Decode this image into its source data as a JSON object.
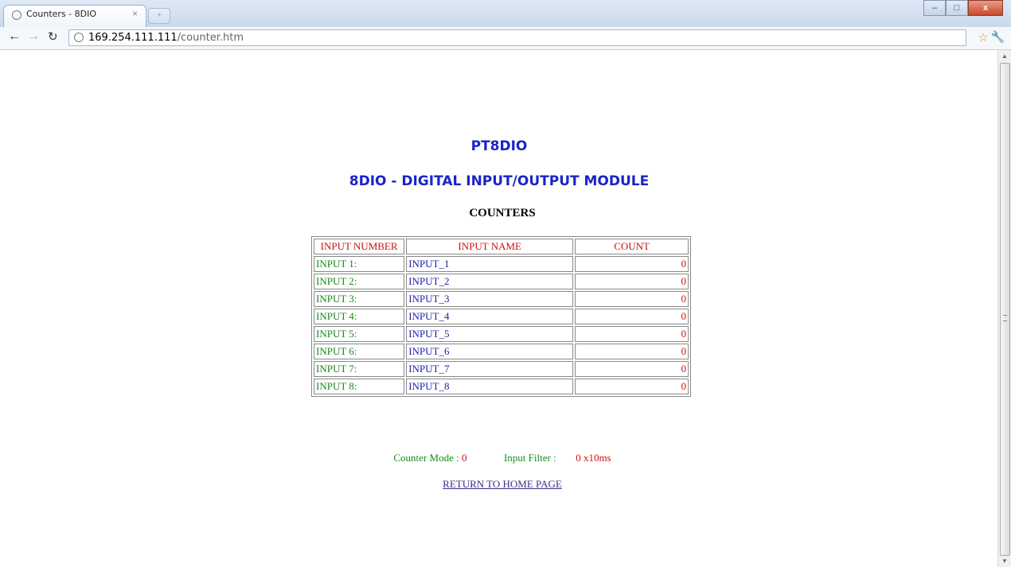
{
  "browser": {
    "tab_title": "Counters - 8DIO",
    "tab_close": "×",
    "url_host": "169.254.111.111",
    "url_path": "/counter.htm",
    "window_buttons": [
      "–",
      "□",
      "x"
    ]
  },
  "page": {
    "title1": "PT8DIO",
    "title2": "8DIO - DIGITAL INPUT/OUTPUT MODULE",
    "title3": "COUNTERS",
    "table": {
      "headers": [
        "INPUT NUMBER",
        "INPUT NAME",
        "COUNT"
      ],
      "rows": [
        {
          "number": "INPUT 1:",
          "name": "INPUT_1",
          "count": "0"
        },
        {
          "number": "INPUT 2:",
          "name": "INPUT_2",
          "count": "0"
        },
        {
          "number": "INPUT 3:",
          "name": "INPUT_3",
          "count": "0"
        },
        {
          "number": "INPUT 4:",
          "name": "INPUT_4",
          "count": "0"
        },
        {
          "number": "INPUT 5:",
          "name": "INPUT_5",
          "count": "0"
        },
        {
          "number": "INPUT 6:",
          "name": "INPUT_6",
          "count": "0"
        },
        {
          "number": "INPUT 7:",
          "name": "INPUT_7",
          "count": "0"
        },
        {
          "number": "INPUT 8:",
          "name": "INPUT_8",
          "count": "0"
        }
      ]
    },
    "counter_mode_label": "Counter Mode :",
    "counter_mode_value": "0",
    "input_filter_label": "Input Filter :",
    "input_filter_value": "0 x10ms",
    "home_link": "RETURN TO HOME PAGE"
  },
  "colors": {
    "title": "#1a24c7",
    "header_text": "#cc1111",
    "number_text": "#1b8a1b",
    "name_text": "#2222aa",
    "count_text": "#cc1111"
  }
}
